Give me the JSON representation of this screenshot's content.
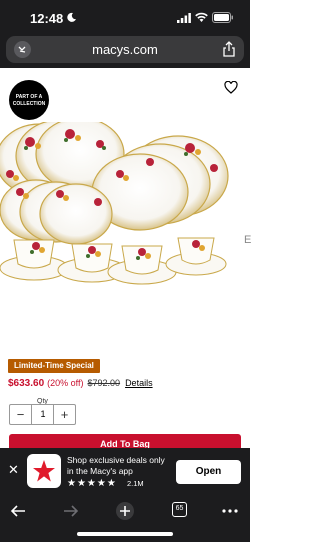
{
  "status": {
    "time": "12:48"
  },
  "browser": {
    "url": "macys.com"
  },
  "product": {
    "badge_text": "PART OF A COLLECTION",
    "promo_tag": "Limited-Time Special",
    "price_now": "$633.60",
    "price_off": "(20% off)",
    "price_was": "$792.00",
    "details_link": "Details",
    "qty_label": "Qty",
    "qty_value": "1",
    "add_to_bag": "Add To Bag"
  },
  "app_banner": {
    "line1": "Shop exclusive deals only",
    "line2": "in the Macy's app",
    "stars": "★★★★★",
    "rating_count": "2.1M",
    "open_label": "Open"
  },
  "toolbar": {
    "tab_count": "65"
  },
  "colors": {
    "brand_red": "#c8102e",
    "promo_orange": "#b65b00",
    "dark_chrome": "#1c1c1e"
  }
}
